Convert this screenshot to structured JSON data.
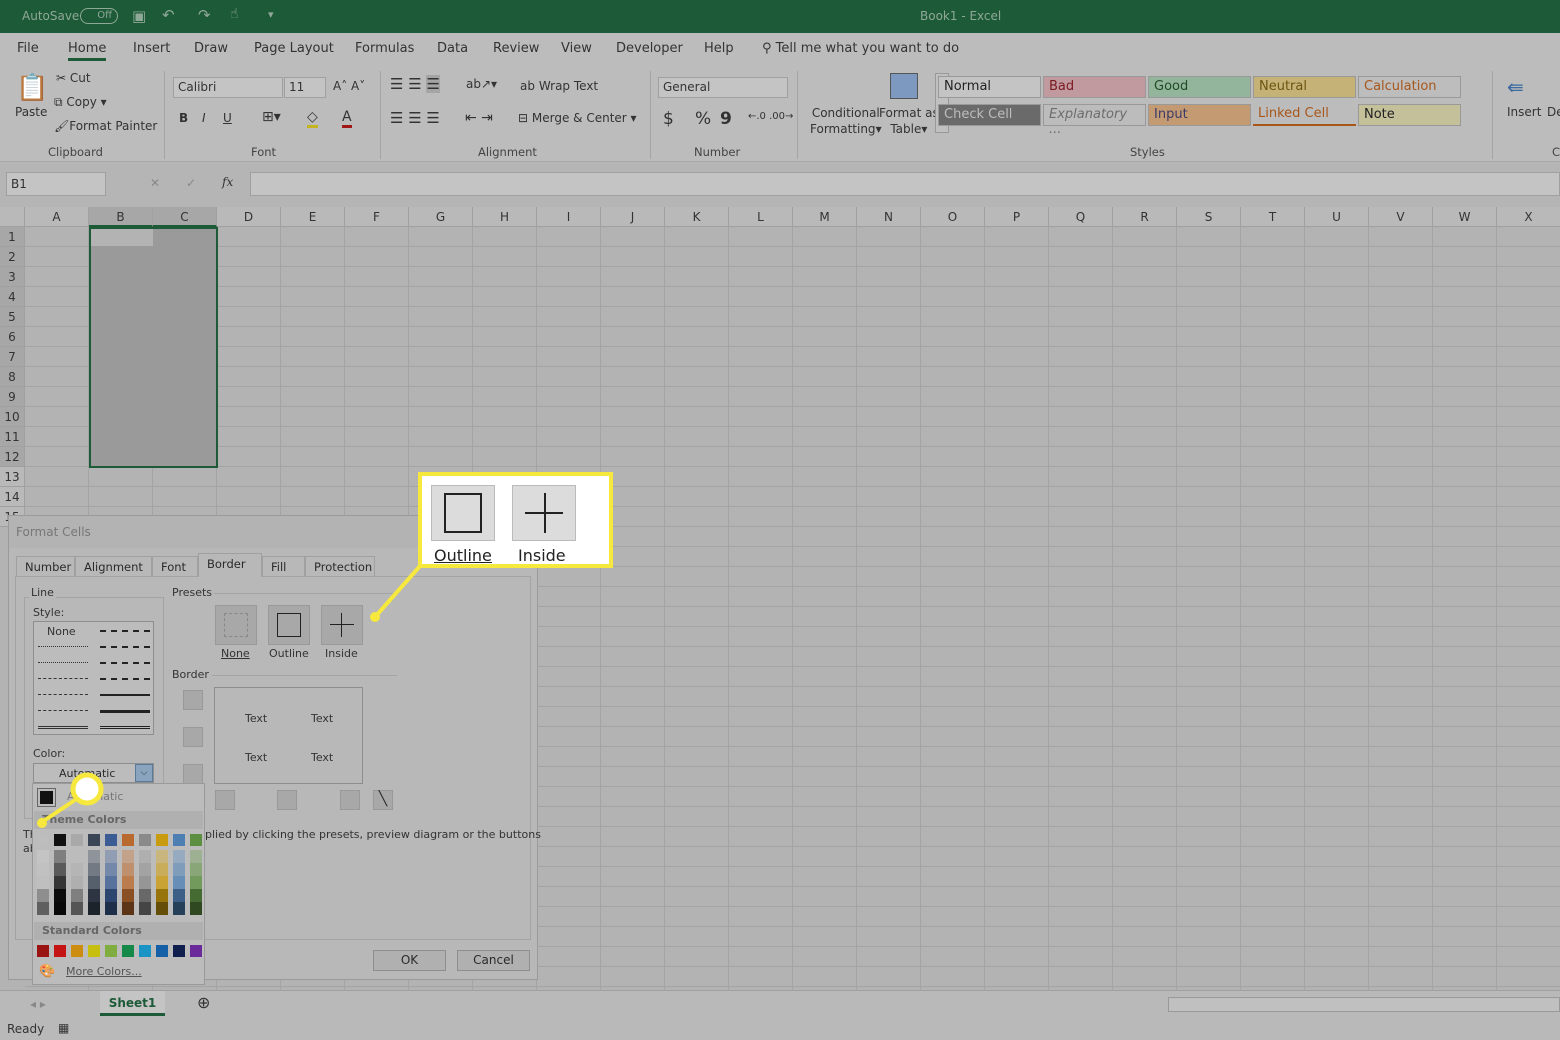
{
  "titlebar": {
    "autosave": "AutoSave",
    "autosave_state": "Off",
    "title": "Book1  -  Excel"
  },
  "tabs": [
    "File",
    "Home",
    "Insert",
    "Draw",
    "Page Layout",
    "Formulas",
    "Data",
    "Review",
    "View",
    "Developer",
    "Help"
  ],
  "active_tab": "Home",
  "tell_me": "Tell me what you want to do",
  "clipboard": {
    "paste": "Paste",
    "cut": "Cut",
    "copy": "Copy",
    "format_painter": "Format Painter",
    "group": "Clipboard"
  },
  "font": {
    "name": "Calibri",
    "size": "11",
    "bold": "B",
    "italic": "I",
    "underline": "U",
    "group": "Font"
  },
  "alignment": {
    "wrap": "Wrap Text",
    "merge": "Merge & Center",
    "group": "Alignment"
  },
  "number": {
    "format": "General",
    "currency": "$",
    "percent": "%",
    "comma": "9",
    "group": "Number"
  },
  "styles": {
    "conditional": "Conditional",
    "conditional2": "Formatting",
    "format_table": "Format as",
    "format_table2": "Table",
    "group": "Styles",
    "cells": [
      {
        "label": "Normal",
        "bg": "#c4c4c4",
        "fg": "#222"
      },
      {
        "label": "Bad",
        "bg": "#c09a9e",
        "fg": "#7a1a22"
      },
      {
        "label": "Good",
        "bg": "#93b59b",
        "fg": "#1f4d26"
      },
      {
        "label": "Neutral",
        "bg": "#c4b277",
        "fg": "#6e5512"
      },
      {
        "label": "Calculation",
        "bg": "#bdbdbd",
        "fg": "#a8561a"
      },
      {
        "label": "Check Cell",
        "bg": "#6a6a6a",
        "fg": "#bdbdbd"
      },
      {
        "label": "Explanatory ...",
        "bg": "#bcbcbc",
        "fg": "#6d6d6d"
      },
      {
        "label": "Input",
        "bg": "#c49a72",
        "fg": "#3b3b6a"
      },
      {
        "label": "Linked Cell",
        "bg": "#bcbcbc",
        "fg": "#a8561a"
      },
      {
        "label": "Note",
        "bg": "#c4c09a",
        "fg": "#222"
      }
    ]
  },
  "cells_group": {
    "insert": "Insert",
    "delete": "De",
    "group": "C"
  },
  "formula": {
    "namebox": "B1",
    "cancel": "✕",
    "enter": "✓",
    "fx": "fx",
    "value": ""
  },
  "columns": [
    "A",
    "B",
    "C",
    "D",
    "E",
    "F",
    "G",
    "H",
    "I",
    "J",
    "K",
    "L",
    "M",
    "N",
    "O",
    "P",
    "Q",
    "R",
    "S",
    "T",
    "U",
    "V",
    "W",
    "X"
  ],
  "rows": [
    "1",
    "2",
    "3",
    "4",
    "5",
    "6",
    "7",
    "8",
    "9",
    "10",
    "11",
    "12",
    "13",
    "14",
    "15"
  ],
  "sheet": {
    "tab": "Sheet1",
    "status": "Ready"
  },
  "dialog": {
    "title": "Format Cells",
    "tabs": [
      "Number",
      "Alignment",
      "Font",
      "Border",
      "Fill",
      "Protection"
    ],
    "active_tab": "Border",
    "line": "Line",
    "style": "Style:",
    "none": "None",
    "color": "Color:",
    "color_value": "Automatic",
    "presets": "Presets",
    "preset_labels": [
      "None",
      "Outline",
      "Inside"
    ],
    "border": "Border",
    "preview_text": "Text",
    "hint": "The selected border style can be applied by clicking the presets, preview diagram or the buttons above.",
    "hint_visible_1": "Th",
    "hint_visible_2": "ab",
    "hint_visible_right": "plied by clicking the presets, preview diagram or the buttons",
    "ok": "OK",
    "cancel": "Cancel"
  },
  "color_dropdown": {
    "automatic": "Automatic",
    "theme": "Theme Colors",
    "standard": "Standard Colors",
    "more": "More Colors...",
    "theme_colors": [
      "#bdbdbd",
      "#111111",
      "#a9a9a9",
      "#3a4656",
      "#3c5d94",
      "#b86a30",
      "#8a8a8a",
      "#c99b10",
      "#4e7fb3",
      "#5d8f42"
    ],
    "standard_colors": [
      "#9a1414",
      "#c41414",
      "#cc8d10",
      "#c7bf10",
      "#7fad40",
      "#16884a",
      "#1a94c4",
      "#1560a6",
      "#101f4d",
      "#6a2a9a"
    ]
  },
  "callout": {
    "outline": "Outline",
    "inside": "Inside"
  },
  "accent": "#1d5a37",
  "highlight": "#f6e83c"
}
